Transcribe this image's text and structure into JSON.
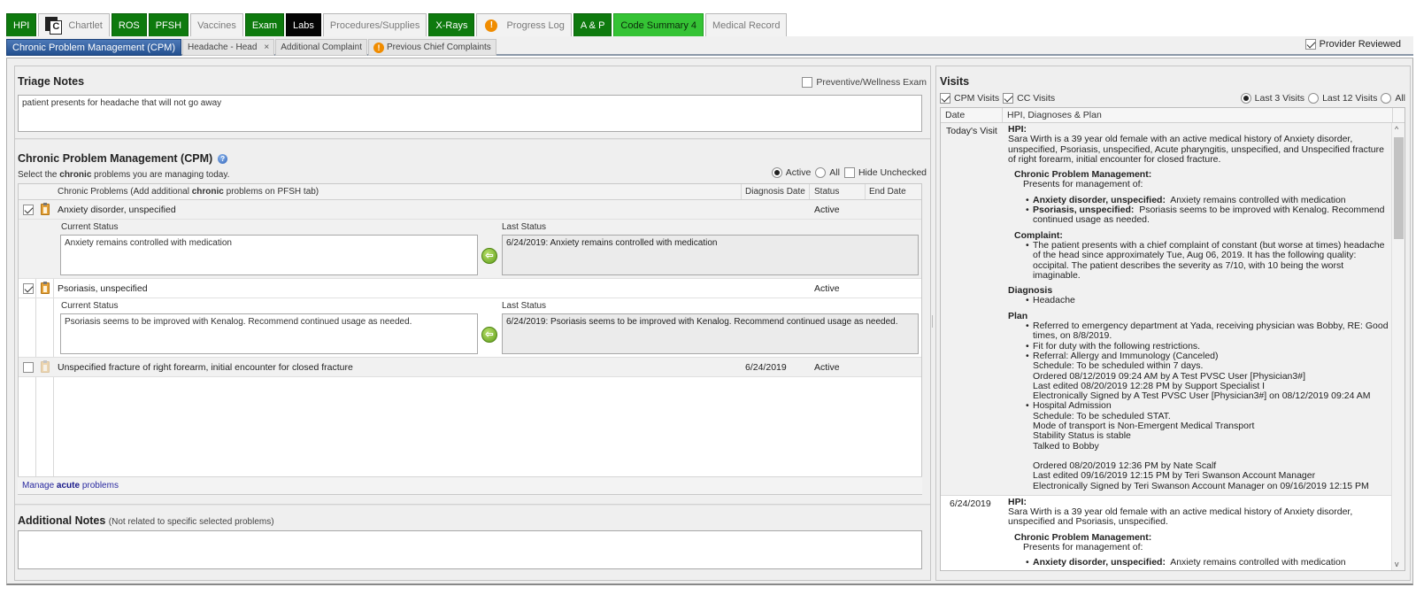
{
  "top_tabs": [
    {
      "label": "HPI",
      "style": "green"
    },
    {
      "label": "Chartlet",
      "style": "plain",
      "icon": "chartlet-icon"
    },
    {
      "label": "ROS",
      "style": "green"
    },
    {
      "label": "PFSH",
      "style": "green"
    },
    {
      "label": "Vaccines",
      "style": "plain"
    },
    {
      "label": "Exam",
      "style": "green"
    },
    {
      "label": "Labs",
      "style": "black"
    },
    {
      "label": "Procedures/Supplies",
      "style": "plain"
    },
    {
      "label": "X-Rays",
      "style": "green"
    },
    {
      "label": "Progress Log",
      "style": "plain",
      "icon": "warning-icon"
    },
    {
      "label": "A & P",
      "style": "green"
    },
    {
      "label": "Code Summary 4",
      "style": "lime"
    },
    {
      "label": "Medical Record",
      "style": "plain"
    }
  ],
  "sub_tabs": [
    {
      "label": "Chronic Problem Management (CPM)",
      "active": true
    },
    {
      "label": "Headache - Head",
      "closable": true
    },
    {
      "label": "Additional Complaint"
    },
    {
      "label": "Previous Chief Complaints",
      "icon": "warning-icon"
    }
  ],
  "icons": {
    "warning": "!",
    "chartlet_letter": "C",
    "close": "×",
    "copy_arrow": "⇦",
    "help": "?",
    "scroll_up": "^",
    "scroll_down": "v"
  },
  "provider_reviewed": {
    "label": "Provider Reviewed",
    "checked": true
  },
  "triage": {
    "title": "Triage Notes",
    "text": "patient presents for headache that will not go away",
    "preventive_label": "Preventive/Wellness Exam",
    "preventive_checked": false
  },
  "cpm": {
    "title": "Chronic Problem Management (CPM)",
    "subtitle_pre": "Select the ",
    "subtitle_bold": "chronic",
    "subtitle_post": " problems you are managing today.",
    "filter_active": "Active",
    "filter_all": "All",
    "filter_selected": "Active",
    "hide_unchecked": "Hide Unchecked",
    "hide_unchecked_checked": false,
    "columns": {
      "problem_pre": "Chronic Problems (Add additional ",
      "problem_bold": "chronic",
      "problem_post": " problems on PFSH tab)",
      "diagnosis_date": "Diagnosis Date",
      "status": "Status",
      "end_date": "End Date"
    },
    "current_status_label": "Current Status",
    "last_status_label": "Last Status",
    "problems": [
      {
        "name": "Anxiety disorder, unspecified",
        "checked": true,
        "diagnosis_date": "",
        "status": "Active",
        "end_date": "",
        "current_status": "Anxiety remains controlled with medication",
        "last_status": "6/24/2019: Anxiety remains controlled with medication"
      },
      {
        "name": "Psoriasis, unspecified",
        "checked": true,
        "diagnosis_date": "",
        "status": "Active",
        "end_date": "",
        "current_status": "Psoriasis seems to be improved with Kenalog. Recommend continued usage as needed.",
        "last_status": "6/24/2019: Psoriasis seems to be improved with Kenalog. Recommend continued usage as needed."
      },
      {
        "name": "Unspecified fracture of right forearm, initial encounter for closed fracture",
        "checked": false,
        "diagnosis_date": "6/24/2019",
        "status": "Active",
        "end_date": ""
      }
    ],
    "manage_pre": "Manage ",
    "manage_bold": "acute",
    "manage_post": " problems"
  },
  "additional_notes": {
    "title": "Additional Notes",
    "hint": "(Not related to specific selected problems)",
    "text": ""
  },
  "visits": {
    "title": "Visits",
    "cpm_visits": "CPM Visits",
    "cc_visits": "CC Visits",
    "range_options": [
      "Last 3 Visits",
      "Last 12 Visits",
      "All"
    ],
    "range_selected": "Last 3 Visits",
    "col_date": "Date",
    "col_content": "HPI, Diagnoses & Plan",
    "rows": [
      {
        "date": "Today's Visit",
        "hpi_label": "HPI:",
        "hpi_text": "Sara Wirth is a 39 year old female with an active medical history of Anxiety disorder, unspecified, Psoriasis, unspecified, Acute pharyngitis, unspecified, and Unspecified fracture of right forearm, initial encounter for closed fracture.",
        "cpm_label": "Chronic Problem Management:",
        "cpm_intro": "Presents for management of:",
        "cpm_items": [
          {
            "name": "Anxiety disorder, unspecified:",
            "text": "Anxiety remains controlled with medication"
          },
          {
            "name": "Psoriasis, unspecified:",
            "text": "Psoriasis seems to be improved with Kenalog. Recommend continued usage as needed."
          }
        ],
        "complaint_label": "Complaint:",
        "complaint_text": "The patient presents with a chief complaint of constant (but worse at times) headache of the head  since approximately Tue, Aug 06, 2019.   It has the following quality: occipital. The patient describes the severity as 7/10, with 10 being the worst imaginable.",
        "diagnosis_label": "Diagnosis",
        "diagnoses": [
          "Headache"
        ],
        "plan_label": "Plan",
        "plan_items": [
          [
            "Referred to emergency department at Yada, receiving physician was Bobby, RE: Good times, on 8/8/2019."
          ],
          [
            "Fit for duty with the following restrictions."
          ],
          [
            "Referral: Allergy and Immunology (Canceled)",
            "Schedule: To be scheduled within 7 days.",
            "Ordered 08/12/2019 09:24 AM by A Test PVSC User [Physician3#]",
            "Last edited 08/20/2019 12:28 PM by Support Specialist I",
            "Electronically Signed by A Test PVSC User [Physician3#] on 08/12/2019 09:24 AM"
          ],
          [
            "Hospital Admission",
            "Schedule: To be scheduled STAT.",
            "Mode of transport is Non-Emergent Medical Transport",
            "Stability Status is stable",
            "Talked to Bobby",
            "",
            "Ordered 08/20/2019 12:36 PM by Nate Scalf",
            "Last edited 09/16/2019 12:15 PM by Teri Swanson Account Manager",
            "Electronically Signed by Teri Swanson Account Manager on 09/16/2019 12:15 PM"
          ]
        ]
      },
      {
        "date": "6/24/2019",
        "hpi_label": "HPI:",
        "hpi_text": "Sara Wirth is a 39 year old female with an active medical history of Anxiety disorder, unspecified and Psoriasis, unspecified.",
        "cpm_label": "Chronic Problem Management:",
        "cpm_intro": "Presents for management of:",
        "cpm_items": [
          {
            "name": "Anxiety disorder, unspecified:",
            "text": "Anxiety remains controlled with medication"
          }
        ]
      }
    ]
  }
}
